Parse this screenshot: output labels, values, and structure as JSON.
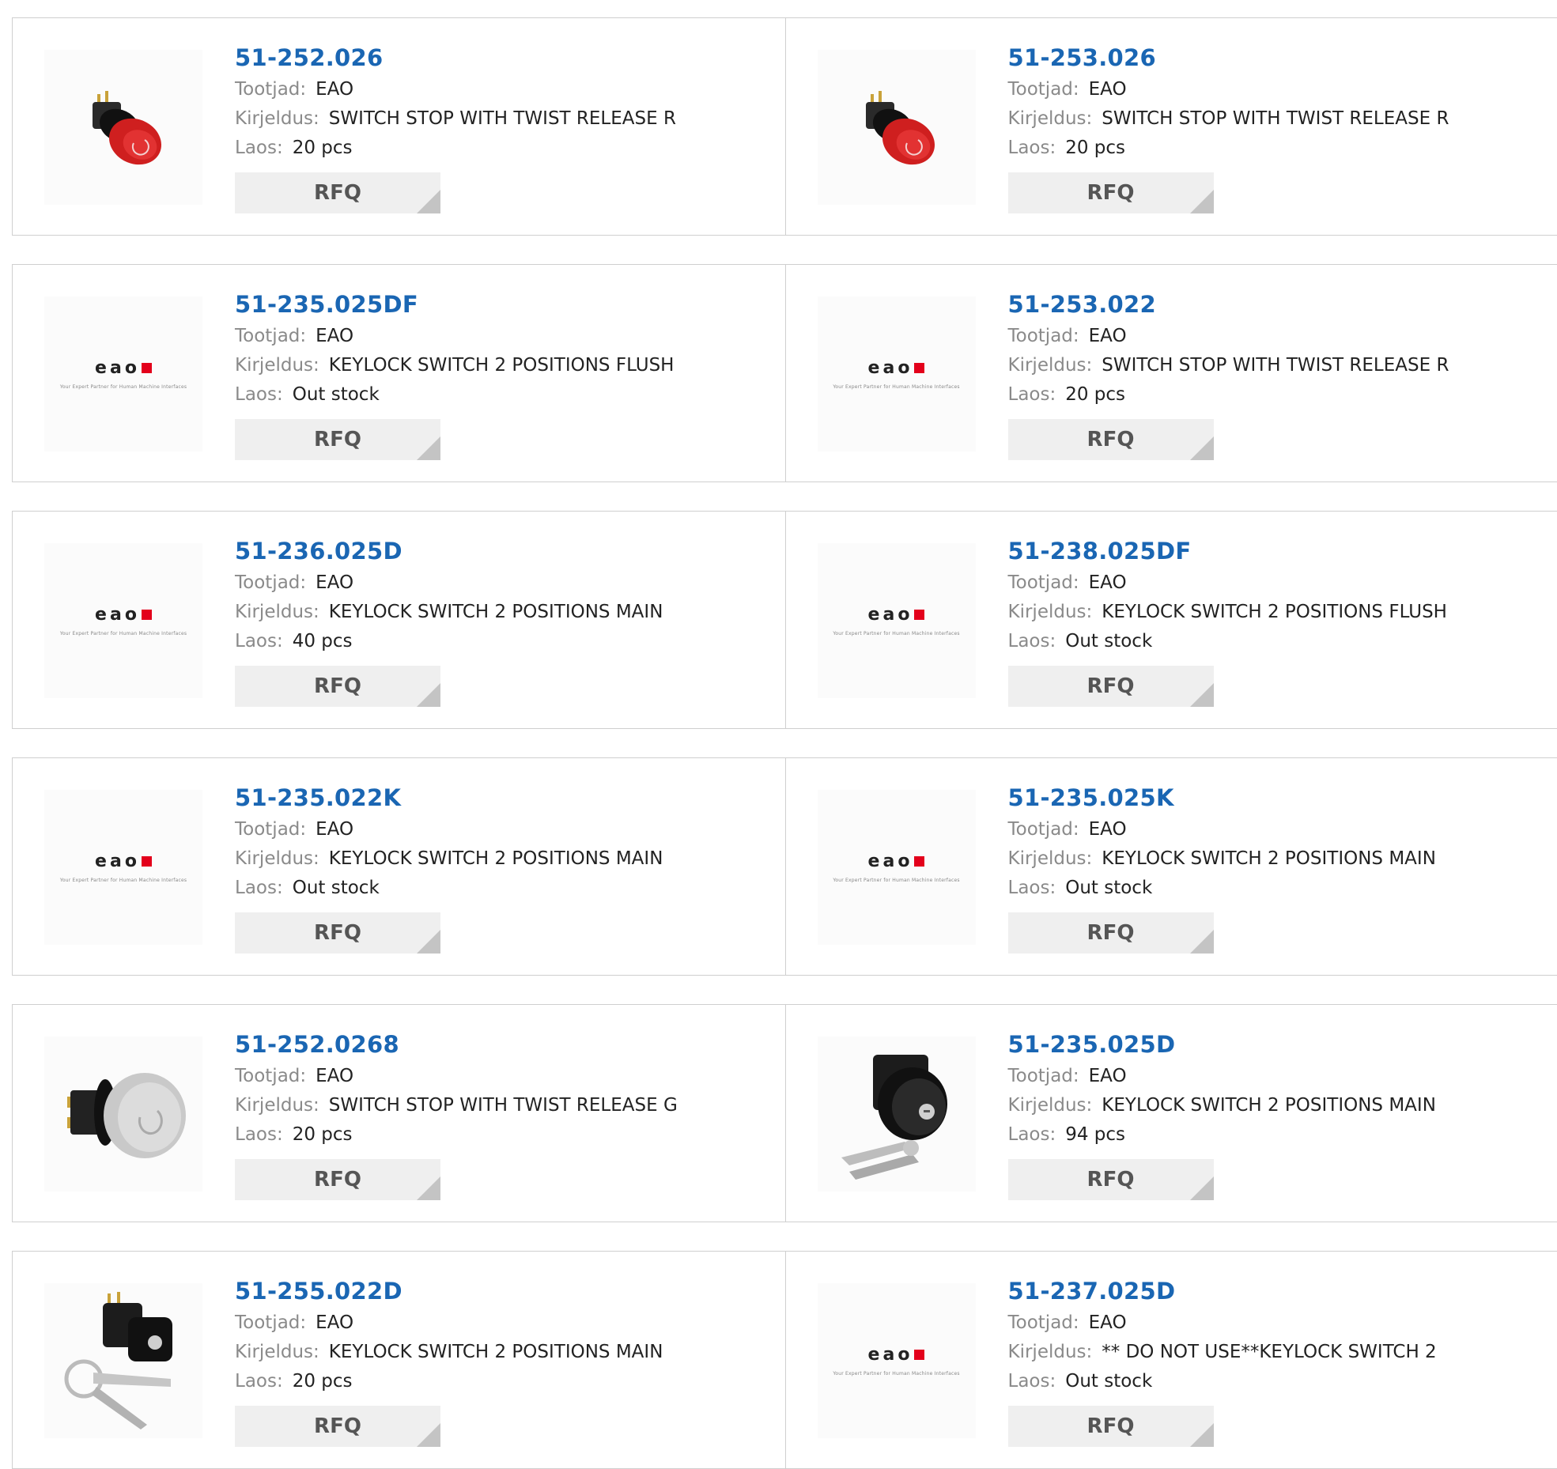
{
  "labels": {
    "manufacturer": "Tootjad:",
    "description": "Kirjeldus:",
    "stock": "Laos:",
    "rfq": "RFQ"
  },
  "logo": {
    "word": "eao",
    "tagline": "Your Expert Partner for Human Machine Interfaces"
  },
  "products": [
    {
      "part": "51-252.026",
      "manufacturer": "EAO",
      "description": "SWITCH STOP WITH TWIST RELEASE R",
      "stock": "20 pcs",
      "image": "red-stop-switch"
    },
    {
      "part": "51-253.026",
      "manufacturer": "EAO",
      "description": "SWITCH STOP WITH TWIST RELEASE R",
      "stock": "20 pcs",
      "image": "red-stop-switch"
    },
    {
      "part": "51-235.025DF",
      "manufacturer": "EAO",
      "description": "KEYLOCK SWITCH 2 POSITIONS FLUSH",
      "stock": "Out stock",
      "image": "eao-logo"
    },
    {
      "part": "51-253.022",
      "manufacturer": "EAO",
      "description": "SWITCH STOP WITH TWIST RELEASE R",
      "stock": "20 pcs",
      "image": "eao-logo"
    },
    {
      "part": "51-236.025D",
      "manufacturer": "EAO",
      "description": "KEYLOCK SWITCH 2 POSITIONS MAIN",
      "stock": "40 pcs",
      "image": "eao-logo"
    },
    {
      "part": "51-238.025DF",
      "manufacturer": "EAO",
      "description": "KEYLOCK SWITCH 2 POSITIONS FLUSH",
      "stock": "Out stock",
      "image": "eao-logo"
    },
    {
      "part": "51-235.022K",
      "manufacturer": "EAO",
      "description": "KEYLOCK SWITCH 2 POSITIONS MAIN",
      "stock": "Out stock",
      "image": "eao-logo"
    },
    {
      "part": "51-235.025K",
      "manufacturer": "EAO",
      "description": "KEYLOCK SWITCH 2 POSITIONS MAIN",
      "stock": "Out stock",
      "image": "eao-logo"
    },
    {
      "part": "51-252.0268",
      "manufacturer": "EAO",
      "description": "SWITCH STOP WITH TWIST RELEASE G",
      "stock": "20 pcs",
      "image": "grey-stop-switch"
    },
    {
      "part": "51-235.025D",
      "manufacturer": "EAO",
      "description": "KEYLOCK SWITCH 2 POSITIONS MAIN",
      "stock": "94 pcs",
      "image": "keylock-round"
    },
    {
      "part": "51-255.022D",
      "manufacturer": "EAO",
      "description": "KEYLOCK SWITCH 2 POSITIONS MAIN",
      "stock": "20 pcs",
      "image": "keylock-square"
    },
    {
      "part": "51-237.025D",
      "manufacturer": "EAO",
      "description": "** DO NOT USE**KEYLOCK SWITCH 2",
      "stock": "Out stock",
      "image": "eao-logo"
    }
  ]
}
